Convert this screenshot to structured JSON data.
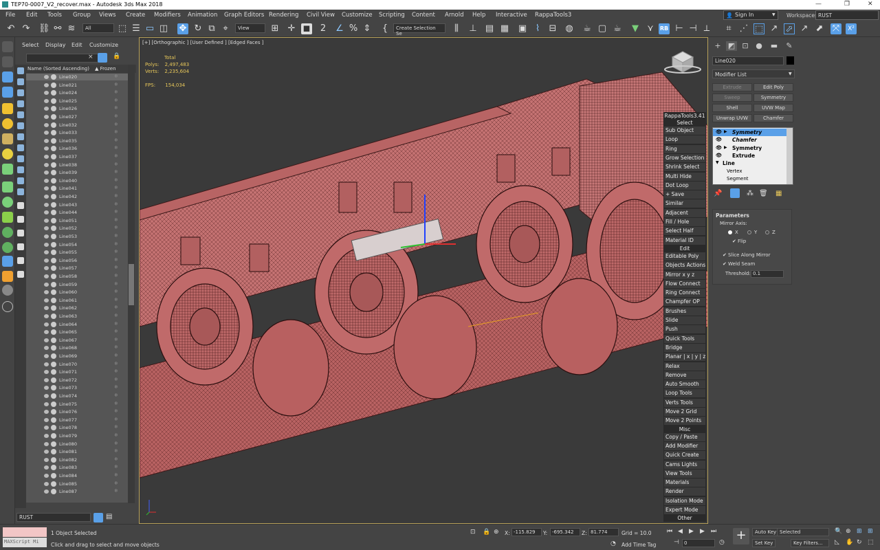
{
  "window": {
    "title": "TEP70-0007_V2_recover.max - Autodesk 3ds Max 2018",
    "minimize": "—",
    "maximize": "❐",
    "close": "✕"
  },
  "menubar": {
    "items": [
      "File",
      "Edit",
      "Tools",
      "Group",
      "Views",
      "Create",
      "Modifiers",
      "Animation",
      "Graph Editors",
      "Rendering",
      "Civil View",
      "Customize",
      "Scripting",
      "Content",
      "Arnold",
      "Help",
      "Interactive",
      "RappaTools3"
    ],
    "signin": "Sign In",
    "workspaces_label": "Workspaces:",
    "workspace_value": "RUST"
  },
  "toolbar": {
    "selection_filter": "All",
    "ref_coord": "View",
    "named_selection": "Create Selection Se"
  },
  "explorer": {
    "menu": [
      "Select",
      "Display",
      "Edit",
      "Customize"
    ],
    "header_name": "Name (Sorted Ascending)",
    "header_frozen": "▲ Frozen",
    "rows": [
      "Line020",
      "Line021",
      "Line024",
      "Line025",
      "Line026",
      "Line027",
      "Line032",
      "Line033",
      "Line035",
      "Line036",
      "Line037",
      "Line038",
      "Line039",
      "Line040",
      "Line041",
      "Line042",
      "Line043",
      "Line044",
      "Line051",
      "Line052",
      "Line053",
      "Line054",
      "Line055",
      "Line056",
      "Line057",
      "Line058",
      "Line059",
      "Line060",
      "Line061",
      "Line062",
      "Line063",
      "Line064",
      "Line065",
      "Line067",
      "Line068",
      "Line069",
      "Line070",
      "Line071",
      "Line072",
      "Line073",
      "Line074",
      "Line075",
      "Line076",
      "Line077",
      "Line078",
      "Line079",
      "Line080",
      "Line081",
      "Line082",
      "Line083",
      "Line084",
      "Line085",
      "Line087"
    ],
    "layer": "RUST"
  },
  "viewport": {
    "label": "[+] [Orthographic ] [User Defined ] [Edged Faces ]",
    "stats_total": "Total",
    "polys_label": "Polys:",
    "polys_value": "2,497,483",
    "verts_label": "Verts:",
    "verts_value": "2,235,604",
    "fps_label": "FPS:",
    "fps_value": "154,034"
  },
  "rappatools": {
    "title": "RappaTools3.41",
    "select_head": "Select",
    "edit_head": "Edit",
    "misc_head": "Misc",
    "other": "Other",
    "select_items": [
      "Sub Object",
      "Loop",
      "Ring",
      "Grow Selection",
      "Shrink Select",
      "Multi Hide",
      "Dot Loop",
      "+ Save",
      "Similar",
      "Adjacent",
      "Fill / Hole",
      "Select Half",
      "Material ID"
    ],
    "edit_items": [
      "Editable Poly",
      "Objects Actions",
      "Mirror   x  y  z",
      "Flow Connect",
      "Ring Connect",
      "Champfer OP",
      "Brushes",
      "Slide",
      "Push",
      "Quick Tools",
      "Bridge",
      "Planar | x | y | z",
      "Relax",
      "Remove",
      "Auto Smooth",
      "Loop Tools",
      "Verts Tools",
      "Move 2 Grid",
      "Move 2 Points"
    ],
    "misc_items": [
      "Copy / Paste",
      "Add Modifier",
      "Quick Create",
      "Cams Lights",
      "View Tools",
      "Materials",
      "Render",
      "Isolation Mode",
      "Expert Mode"
    ]
  },
  "command_panel": {
    "object_name": "Line020",
    "modifier_list": "Modifier List",
    "buttons": [
      {
        "label": "Extrude",
        "enabled": false
      },
      {
        "label": "Edit Poly",
        "enabled": true
      },
      {
        "label": "Sweep",
        "enabled": false
      },
      {
        "label": "Symmetry",
        "enabled": true
      },
      {
        "label": "Shell",
        "enabled": true
      },
      {
        "label": "UVW Map",
        "enabled": true
      },
      {
        "label": "Unwrap UVW",
        "enabled": true
      },
      {
        "label": "Chamfer",
        "enabled": true
      }
    ],
    "stack": [
      "Symmetry",
      "Chamfer",
      "Symmetry",
      "Extrude",
      "Line",
      "Vertex",
      "Segment"
    ],
    "params_title": "Parameters",
    "mirror_axis": "Mirror Axis:",
    "axis_x": "X",
    "axis_y": "Y",
    "axis_z": "Z",
    "flip": "Flip",
    "slice": "Slice Along Mirror",
    "weld": "Weld Seam",
    "threshold_label": "Threshold:",
    "threshold_value": "0.1"
  },
  "status": {
    "maxscript": "MAXScript Mi",
    "selected": "1 Object Selected",
    "prompt": "Click and drag to select and move objects",
    "x_label": "X:",
    "x_value": "-115.829",
    "y_label": "Y:",
    "y_value": "-695.342",
    "z_label": "Z:",
    "z_value": "81.774",
    "grid": "Grid = 10.0",
    "add_time_tag": "Add Time Tag",
    "frame": "0",
    "auto_key": "Auto Key",
    "set_key": "Set Key",
    "key_mode": "Selected",
    "key_filters": "Key Filters..."
  },
  "colors": {
    "model": "#c86e6e",
    "wire": "#3a1818",
    "accent": "#5aa0e8",
    "viewport_border": "#b7a15a"
  }
}
